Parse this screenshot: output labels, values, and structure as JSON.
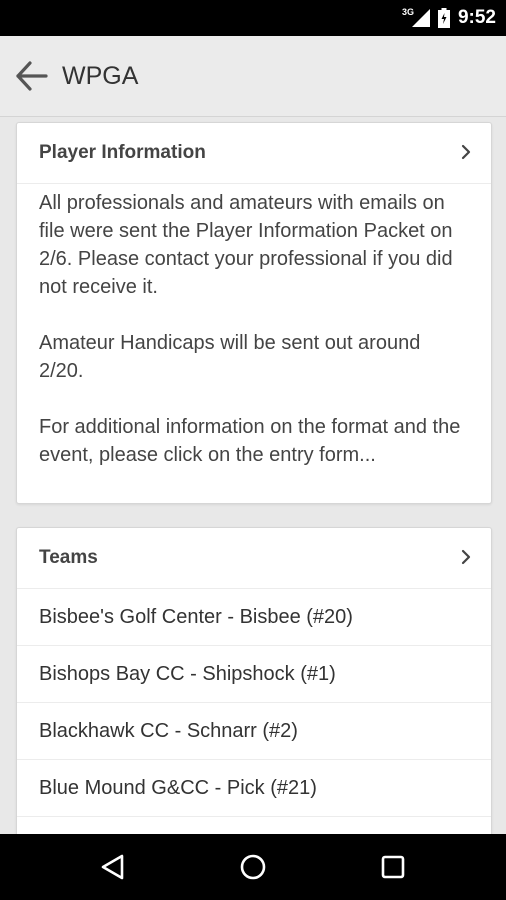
{
  "status_bar": {
    "network": "3G",
    "time": "9:52",
    "icons": [
      "signal-icon",
      "battery-icon"
    ]
  },
  "app_bar": {
    "title": "WPGA",
    "back_icon": "arrow-left-icon"
  },
  "player_info_card": {
    "title": "Player Information",
    "paragraphs": [
      "All professionals and amateurs with emails on file were sent the Player Information Packet on 2/6. Please contact your professional if you did not receive it.",
      "Amateur Handicaps will be sent out around 2/20.",
      "For additional information on the format and the event, please click on the entry form..."
    ]
  },
  "teams_card": {
    "title": "Teams",
    "items": [
      "Bisbee's Golf Center - Bisbee (#20)",
      "Bishops Bay CC - Shipshock (#1)",
      "Blackhawk CC - Schnarr (#2)",
      "Blue Mound G&CC - Pick (#21)"
    ]
  },
  "nav_bar": {
    "icons": [
      "back-triangle-icon",
      "home-circle-icon",
      "recents-square-icon"
    ]
  }
}
